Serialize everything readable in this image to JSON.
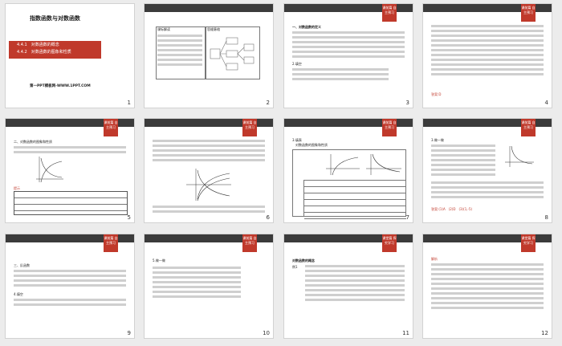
{
  "slides": [
    {
      "n": "1",
      "title": "指数函数与对数函数",
      "sub1": "4.4.1　对数函数的概念",
      "sub2": "4.4.2　对数函数的图象和性质",
      "site": "第一PPT模板网-WWW.1PPT.COM"
    },
    {
      "n": "2",
      "left_head": "课标解读",
      "right_head": "思维脉络"
    },
    {
      "n": "3",
      "tag": "课前篇 自主预习",
      "h1": "一、对数函数的定义",
      "h2": "2.填空"
    },
    {
      "n": "4",
      "tag": "课前篇 自主预习",
      "ans": "答案:D"
    },
    {
      "n": "5",
      "tag": "课前篇 自主预习",
      "h1": "二、对数函数的图象和性质",
      "tip": "提示"
    },
    {
      "n": "6",
      "tag": "课前篇 自主预习"
    },
    {
      "n": "7",
      "tag": "课前篇 自主预习",
      "h1": "3.填表",
      "h2": "对数函数的图象和性质"
    },
    {
      "n": "8",
      "tag": "课前篇 自主预习",
      "h1": "3.做一做",
      "ans": "答案:(1)A　(2)D　(3)(1,-5)"
    },
    {
      "n": "9",
      "tag": "课前篇 自主预习",
      "h1": "三、反函数",
      "h2": "4.填空"
    },
    {
      "n": "10",
      "tag": "课前篇 自主预习",
      "h1": "5.做一做"
    },
    {
      "n": "11",
      "tag": "课堂篇 探究学习",
      "h1": "对数函数的概念",
      "h2": "例1"
    },
    {
      "n": "12",
      "tag": "课堂篇 探究学习",
      "h1": "解析"
    }
  ]
}
